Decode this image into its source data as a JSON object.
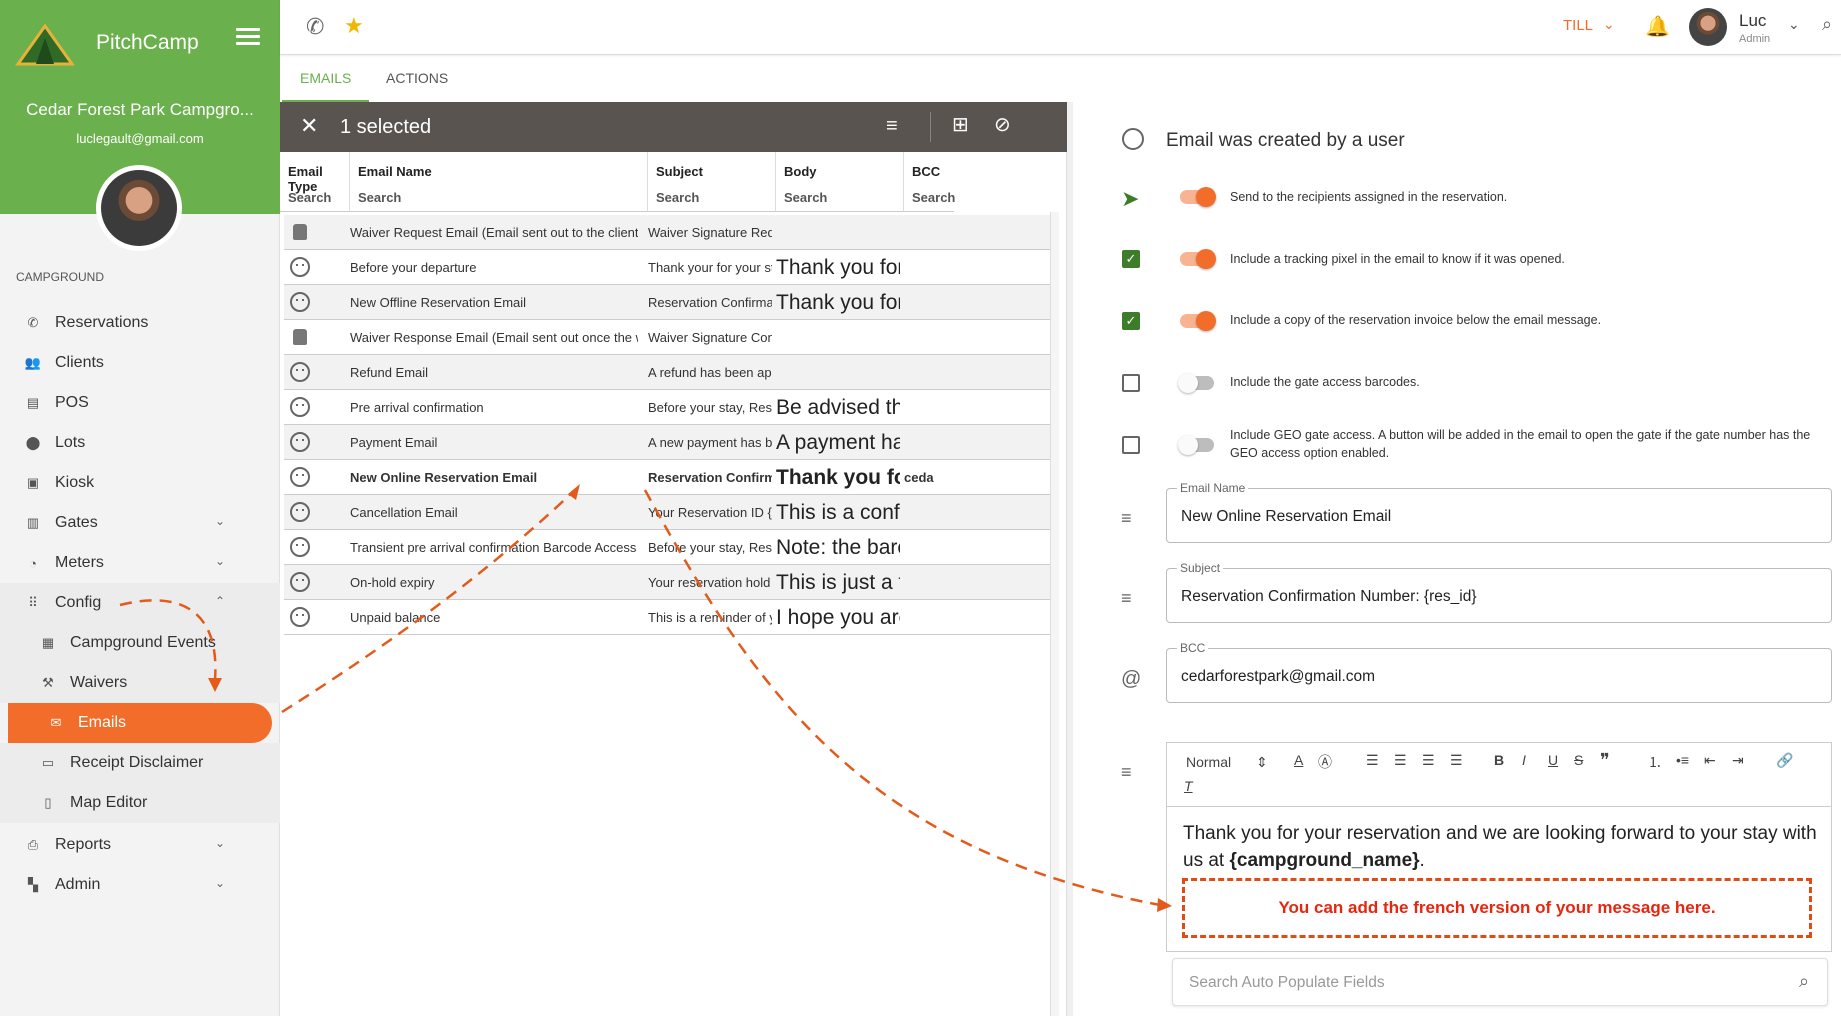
{
  "sidebar": {
    "brand": "PitchCamp",
    "campground_name": "Cedar Forest Park Campgro...",
    "email": "luclegault@gmail.com",
    "section_label": "CAMPGROUND",
    "items": [
      {
        "label": "Reservations",
        "icon": "phone-icon"
      },
      {
        "label": "Clients",
        "icon": "people-icon"
      },
      {
        "label": "POS",
        "icon": "register-icon"
      },
      {
        "label": "Lots",
        "icon": "pin-icon"
      },
      {
        "label": "Kiosk",
        "icon": "kiosk-icon"
      },
      {
        "label": "Gates",
        "icon": "gate-icon"
      },
      {
        "label": "Meters",
        "icon": "meter-icon"
      },
      {
        "label": "Config",
        "icon": "grid-icon"
      },
      {
        "label": "Campground Events",
        "icon": "calendar-icon"
      },
      {
        "label": "Waivers",
        "icon": "gavel-icon"
      },
      {
        "label": "Emails",
        "icon": "mail-icon"
      },
      {
        "label": "Receipt Disclaimer",
        "icon": "receipt-icon"
      },
      {
        "label": "Map Editor",
        "icon": "map-icon"
      },
      {
        "label": "Reports",
        "icon": "print-icon"
      },
      {
        "label": "Admin",
        "icon": "dashboard-icon"
      }
    ]
  },
  "topbar": {
    "till": "TILL",
    "user_name": "Luc",
    "user_role": "Admin"
  },
  "tabs": [
    "EMAILS",
    "ACTIONS"
  ],
  "list": {
    "selected_text": "1 selected",
    "columns": [
      {
        "title": "Email Type",
        "search": "Search"
      },
      {
        "title": "Email Name",
        "search": "Search"
      },
      {
        "title": "Subject",
        "search": "Search"
      },
      {
        "title": "Body",
        "search": "Search"
      },
      {
        "title": "BCC",
        "search": "Search"
      }
    ],
    "rows": [
      {
        "type": "robot",
        "name": "Waiver Request Email (Email sent out to the client to sign t",
        "subject": "Waiver Signature Reque",
        "body": "",
        "bcc": ""
      },
      {
        "type": "user",
        "name": "Before your departure",
        "subject": "Thank your for your sta",
        "body": "Thank you for c",
        "bcc": ""
      },
      {
        "type": "user",
        "name": "New Offline Reservation Email",
        "subject": "Reservation Confirmatio",
        "body": "Thank you for y",
        "bcc": ""
      },
      {
        "type": "robot",
        "name": "Waiver Response Email (Email sent out once the waiver ha",
        "subject": "Waiver Signature Confir",
        "body": "",
        "bcc": ""
      },
      {
        "type": "user",
        "name": "Refund Email",
        "subject": "A refund has been appl",
        "body": "",
        "bcc": ""
      },
      {
        "type": "user",
        "name": "Pre arrival confirmation",
        "subject": "Before your stay, Reser",
        "body": "Be advised that",
        "bcc": ""
      },
      {
        "type": "user",
        "name": "Payment Email",
        "subject": "A new payment has bee",
        "body": "A payment has",
        "bcc": ""
      },
      {
        "type": "user",
        "name": "New Online Reservation Email",
        "subject": "Reservation Confirmati",
        "body": "Thank you for y",
        "bcc": "ceda"
      },
      {
        "type": "user",
        "name": "Cancellation Email",
        "subject": "Your Reservation ID {re:",
        "body": "This is a confirr",
        "bcc": ""
      },
      {
        "type": "user",
        "name": "Transient pre arrival confirmation Barcode Access",
        "subject": "Before your stay, Reser",
        "body": "Note: the barco",
        "bcc": ""
      },
      {
        "type": "user",
        "name": "On-hold expiry",
        "subject": "Your reservation hold is",
        "body": "This is just a fri",
        "bcc": ""
      },
      {
        "type": "user",
        "name": "Unpaid balance",
        "subject": "This is a reminder of yo",
        "body": "I hope you are v",
        "bcc": ""
      }
    ]
  },
  "detail": {
    "title": "Email was created by a user",
    "options": [
      {
        "text": "Send to the recipients assigned in the reservation.",
        "on": true
      },
      {
        "text": "Include a tracking pixel in the email to know if it was opened.",
        "on": true
      },
      {
        "text": "Include a copy of the reservation invoice below the email message.",
        "on": true
      },
      {
        "text": "Include the gate access barcodes.",
        "on": false
      },
      {
        "text": "Include GEO gate access. A button will be added in the email to open the gate if the gate number has the GEO access option enabled.",
        "on": false
      }
    ],
    "email_name_label": "Email Name",
    "email_name": "New Online Reservation Email",
    "subject_label": "Subject",
    "subject": "Reservation Confirmation Number: {res_id}",
    "bcc_label": "BCC",
    "bcc": "cedarforestpark@gmail.com",
    "editor_format": "Normal",
    "body_text": "Thank you for your reservation and we are looking forward to your stay with us at ",
    "body_bold": "{campground_name}",
    "body_end": ".",
    "french_note": "You can add the french version of your message here.",
    "search_placeholder": "Search Auto Populate Fields"
  },
  "colors": {
    "green": "#6ab04c",
    "orange": "#f26d2a",
    "dark": "#5a5450"
  }
}
